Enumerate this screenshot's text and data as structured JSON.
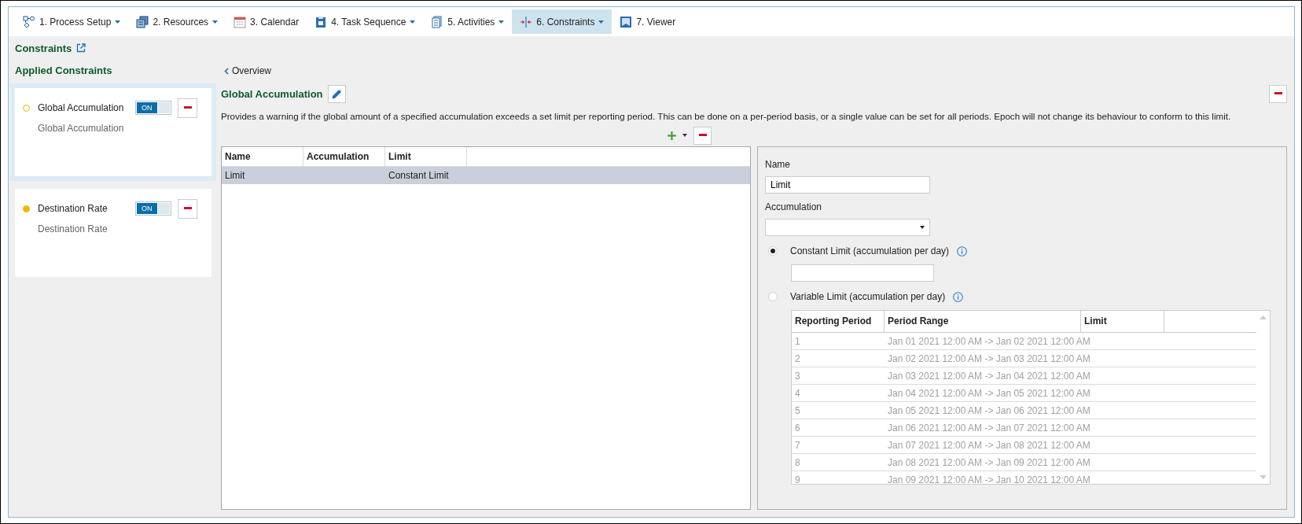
{
  "toolbar": {
    "tabs": [
      {
        "label": "1. Process Setup",
        "kind": "flowchart",
        "dropdown": true,
        "selected": false
      },
      {
        "label": "2. Resources",
        "kind": "documents",
        "dropdown": true,
        "selected": false
      },
      {
        "label": "3. Calendar",
        "kind": "calendar",
        "dropdown": false,
        "selected": false
      },
      {
        "label": "4. Task Sequence",
        "kind": "clipboard",
        "dropdown": true,
        "selected": false
      },
      {
        "label": "5. Activities",
        "kind": "document",
        "dropdown": true,
        "selected": false
      },
      {
        "label": "6. Constraints",
        "kind": "split",
        "dropdown": true,
        "selected": true
      },
      {
        "label": "7. Viewer",
        "kind": "book",
        "dropdown": false,
        "selected": false
      }
    ]
  },
  "page": {
    "title": "Constraints"
  },
  "sidebar": {
    "heading": "Applied Constraints",
    "items": [
      {
        "name": "Global Accumulation",
        "description": "Global Accumulation",
        "dot_filled": false,
        "on": true,
        "toggle_label": "ON",
        "selected": true
      },
      {
        "name": "Destination Rate",
        "description": "Destination Rate",
        "dot_filled": true,
        "on": true,
        "toggle_label": "ON",
        "selected": false
      }
    ]
  },
  "main": {
    "back_link": "Overview",
    "title": "Global Accumulation",
    "description": "Provides a warning if the global amount of a specified accumulation exceeds a set limit per reporting period. This can be done on a per-period basis, or a single value can be set for all periods. Epoch will not change its behaviour to conform to this limit.",
    "table": {
      "columns": [
        "Name",
        "Accumulation",
        "Limit"
      ],
      "rows": [
        {
          "name": "Limit",
          "limit": "Constant Limit",
          "selected": true
        }
      ]
    },
    "details": {
      "name_label": "Name",
      "name_value": "Limit",
      "accumulation_label": "Accumulation",
      "options": [
        {
          "label": "Constant Limit (accumulation per day)",
          "selected": true,
          "kind": "constant"
        },
        {
          "label": "Variable Limit (accumulation per day)",
          "selected": false,
          "kind": "variable"
        }
      ],
      "periods": {
        "disabled": true,
        "columns": [
          "Reporting Period",
          "Period Range",
          "Limit"
        ],
        "rows": [
          {
            "period": "1",
            "range": "Jan 01 2021 12:00 AM -> Jan 02 2021 12:00 AM"
          },
          {
            "period": "2",
            "range": "Jan 02 2021 12:00 AM -> Jan 03 2021 12:00 AM"
          },
          {
            "period": "3",
            "range": "Jan 03 2021 12:00 AM -> Jan 04 2021 12:00 AM"
          },
          {
            "period": "4",
            "range": "Jan 04 2021 12:00 AM -> Jan 05 2021 12:00 AM"
          },
          {
            "period": "5",
            "range": "Jan 05 2021 12:00 AM -> Jan 06 2021 12:00 AM"
          },
          {
            "period": "6",
            "range": "Jan 06 2021 12:00 AM -> Jan 07 2021 12:00 AM"
          },
          {
            "period": "7",
            "range": "Jan 07 2021 12:00 AM -> Jan 08 2021 12:00 AM"
          },
          {
            "period": "8",
            "range": "Jan 08 2021 12:00 AM -> Jan 09 2021 12:00 AM"
          },
          {
            "period": "9",
            "range": "Jan 09 2021 12:00 AM -> Jan 10 2021 12:00 AM"
          }
        ]
      }
    }
  }
}
